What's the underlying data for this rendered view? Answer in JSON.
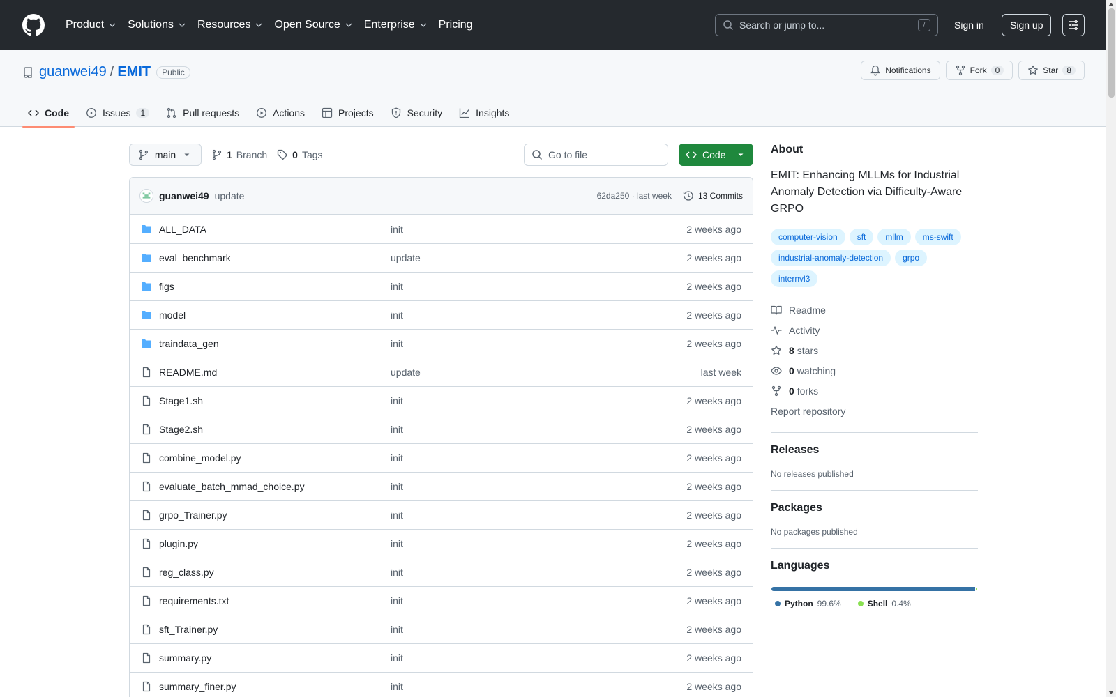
{
  "header": {
    "nav": [
      "Product",
      "Solutions",
      "Resources",
      "Open Source",
      "Enterprise",
      "Pricing"
    ],
    "search_placeholder": "Search or jump to...",
    "search_shortcut": "/",
    "signin": "Sign in",
    "signup": "Sign up"
  },
  "repo": {
    "owner": "guanwei49",
    "separator": "/",
    "name": "EMIT",
    "visibility": "Public",
    "notifications": "Notifications",
    "fork_label": "Fork",
    "fork_count": "0",
    "star_label": "Star",
    "star_count": "8",
    "tabs": [
      {
        "label": "Code"
      },
      {
        "label": "Issues",
        "count": "1"
      },
      {
        "label": "Pull requests"
      },
      {
        "label": "Actions"
      },
      {
        "label": "Projects"
      },
      {
        "label": "Security"
      },
      {
        "label": "Insights"
      }
    ]
  },
  "toolbar": {
    "branch": "main",
    "branch_count": "1",
    "branch_label": "Branch",
    "tag_count": "0",
    "tag_label": "Tags",
    "goto_placeholder": "Go to file",
    "code_button": "Code"
  },
  "commit": {
    "author": "guanwei49",
    "message": "update",
    "sha_time": "62da250 · last week",
    "commits": "13 Commits"
  },
  "files": [
    {
      "type": "dir",
      "name": "ALL_DATA",
      "message": "init",
      "date": "2 weeks ago"
    },
    {
      "type": "dir",
      "name": "eval_benchmark",
      "message": "update",
      "date": "2 weeks ago"
    },
    {
      "type": "dir",
      "name": "figs",
      "message": "init",
      "date": "2 weeks ago"
    },
    {
      "type": "dir",
      "name": "model",
      "message": "init",
      "date": "2 weeks ago"
    },
    {
      "type": "dir",
      "name": "traindata_gen",
      "message": "init",
      "date": "2 weeks ago"
    },
    {
      "type": "file",
      "name": "README.md",
      "message": "update",
      "date": "last week"
    },
    {
      "type": "file",
      "name": "Stage1.sh",
      "message": "init",
      "date": "2 weeks ago"
    },
    {
      "type": "file",
      "name": "Stage2.sh",
      "message": "init",
      "date": "2 weeks ago"
    },
    {
      "type": "file",
      "name": "combine_model.py",
      "message": "init",
      "date": "2 weeks ago"
    },
    {
      "type": "file",
      "name": "evaluate_batch_mmad_choice.py",
      "message": "init",
      "date": "2 weeks ago"
    },
    {
      "type": "file",
      "name": "grpo_Trainer.py",
      "message": "init",
      "date": "2 weeks ago"
    },
    {
      "type": "file",
      "name": "plugin.py",
      "message": "init",
      "date": "2 weeks ago"
    },
    {
      "type": "file",
      "name": "reg_class.py",
      "message": "init",
      "date": "2 weeks ago"
    },
    {
      "type": "file",
      "name": "requirements.txt",
      "message": "init",
      "date": "2 weeks ago"
    },
    {
      "type": "file",
      "name": "sft_Trainer.py",
      "message": "init",
      "date": "2 weeks ago"
    },
    {
      "type": "file",
      "name": "summary.py",
      "message": "init",
      "date": "2 weeks ago"
    },
    {
      "type": "file",
      "name": "summary_finer.py",
      "message": "init",
      "date": "2 weeks ago"
    }
  ],
  "about": {
    "title": "About",
    "description": "EMIT: Enhancing MLLMs for Industrial Anomaly Detection via Difficulty-Aware GRPO",
    "topics": [
      "computer-vision",
      "sft",
      "mllm",
      "ms-swift",
      "industrial-anomaly-detection",
      "grpo",
      "internvl3"
    ],
    "readme": "Readme",
    "activity": "Activity",
    "stars_count": "8",
    "stars_label": "stars",
    "watching_count": "0",
    "watching_label": "watching",
    "forks_count": "0",
    "forks_label": "forks",
    "report": "Report repository"
  },
  "releases": {
    "title": "Releases",
    "empty": "No releases published"
  },
  "packages": {
    "title": "Packages",
    "empty": "No packages published"
  },
  "languages": {
    "title": "Languages",
    "items": [
      {
        "name": "Python",
        "percent": "99.6%",
        "value": 99.6,
        "color": "#3572A5"
      },
      {
        "name": "Shell",
        "percent": "0.4%",
        "value": 0.4,
        "color": "#89e051"
      }
    ]
  },
  "colors": {
    "accent": "#0969da",
    "header_bg": "#25292e",
    "primary_button": "#1f883d",
    "folder": "#54aeff",
    "tab_underline": "#fd8c73"
  }
}
